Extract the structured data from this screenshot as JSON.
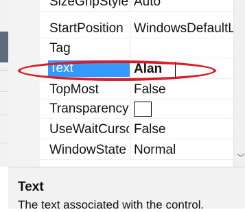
{
  "properties": [
    {
      "name": "SizeGripStyle",
      "value": "Auto"
    },
    {
      "name": "StartPosition",
      "value": "WindowsDefaultLocation"
    },
    {
      "name": "Tag",
      "value": ""
    },
    {
      "name": "Text",
      "value": "Alan",
      "selected": true
    },
    {
      "name": "TopMost",
      "value": "False"
    },
    {
      "name": "Transparency",
      "value": ""
    },
    {
      "name": "UseWaitCursor",
      "value": "False"
    },
    {
      "name": "WindowState",
      "value": "Normal"
    }
  ],
  "description": {
    "title": "Text",
    "text": "The text associated with the control."
  },
  "colors": {
    "selection": "#3399ff",
    "annotation_oval": "#d81e2a"
  },
  "icons": {
    "left_close": "close-icon",
    "scroll_down": "chevron-down-icon"
  }
}
